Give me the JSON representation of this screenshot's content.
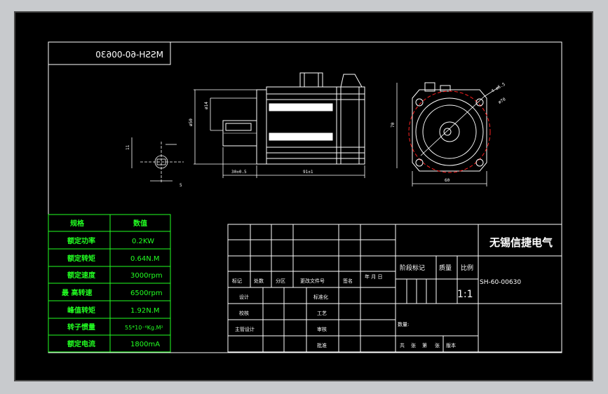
{
  "title_block": {
    "company": "无锡信捷电气",
    "drawing_no": "SH-60-00630",
    "scale": "1:1",
    "header_row": [
      "标记",
      "处数",
      "分区",
      "更改文件号",
      "签名",
      "年 月 日"
    ],
    "rows": [
      "设计",
      "校核",
      "主管设计"
    ],
    "mid_labels": [
      "标准化",
      "工艺",
      "审核",
      "批准"
    ],
    "stage_labels": [
      "阶段标记",
      "质量",
      "比例"
    ],
    "weight_label": "数量:",
    "sheet_total": "共",
    "sheet_unit1": "张",
    "sheet_no": "第",
    "sheet_unit2": "张",
    "version": "版本"
  },
  "mirrored_label": "MSSH-60-00630",
  "spec_table": {
    "headers": [
      "规格",
      "数值"
    ],
    "rows": [
      [
        "额定功率",
        "0.2KW"
      ],
      [
        "额定转矩",
        "0.64N.M"
      ],
      [
        "额定速度",
        "3000rpm"
      ],
      [
        "最 高转速",
        "6500rpm"
      ],
      [
        "峰值转矩",
        "1.92N.M"
      ],
      [
        "转子惯量",
        "55*10⁻⁶Kg.M²"
      ],
      [
        "额定电流",
        "1800mA"
      ]
    ]
  },
  "dims": {
    "shaft_len": "30±0.5",
    "body_len": "91±1",
    "flange_height": "60",
    "square_width": "60",
    "dia1": "ø50",
    "dia2": "ø14",
    "hole": "4-ø5.5",
    "pcd": "ø70",
    "key_w": "5",
    "key_h": "11",
    "side_dim": "70"
  },
  "colors": {
    "frame_bg": "#000000",
    "line": "#ffffff",
    "table": "#22ff22",
    "center": "#ff2020"
  }
}
